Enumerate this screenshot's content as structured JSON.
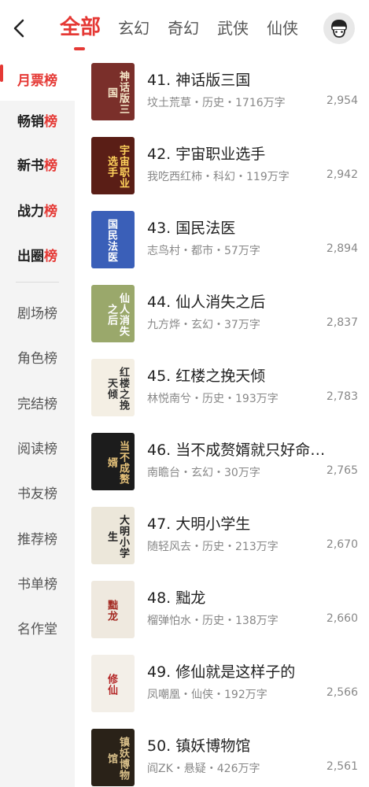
{
  "header": {
    "tabs": [
      "全部",
      "玄幻",
      "奇幻",
      "武侠",
      "仙侠"
    ],
    "active_tab": 0
  },
  "sidebar": {
    "primary": [
      "月票榜",
      "畅销榜",
      "新书榜",
      "战力榜",
      "出圈榜"
    ],
    "secondary": [
      "剧场榜",
      "角色榜",
      "完结榜",
      "阅读榜",
      "书友榜",
      "推荐榜",
      "书单榜",
      "名作堂"
    ]
  },
  "books": [
    {
      "title": "41. 神话版三国",
      "meta": "坟土荒草・历史・1716万字",
      "count": "2,954",
      "cover_text": "神话版三国",
      "cover_bg": "#7a2f2a",
      "cover_fg": "#f5e6c8"
    },
    {
      "title": "42. 宇宙职业选手",
      "meta": "我吃西红柿・科幻・119万字",
      "count": "2,942",
      "cover_text": "宇宙职业选手",
      "cover_bg": "#5a1e16",
      "cover_fg": "#ffd35c"
    },
    {
      "title": "43. 国民法医",
      "meta": "志鸟村・都市・57万字",
      "count": "2,894",
      "cover_text": "国民法医",
      "cover_bg": "#3a5fb8",
      "cover_fg": "#ffffff"
    },
    {
      "title": "44. 仙人消失之后",
      "meta": "九方烨・玄幻・37万字",
      "count": "2,837",
      "cover_text": "仙人消失之后",
      "cover_bg": "#9aa86b",
      "cover_fg": "#ffffff"
    },
    {
      "title": "45. 红楼之挽天倾",
      "meta": "林悦南兮・历史・193万字",
      "count": "2,783",
      "cover_text": "红楼之挽天倾",
      "cover_bg": "#f4efe4",
      "cover_fg": "#333333"
    },
    {
      "title": "46. 当不成赘婿就只好命…",
      "meta": "南瞻台・玄幻・30万字",
      "count": "2,765",
      "cover_text": "当不成赘婿",
      "cover_bg": "#1c1c1c",
      "cover_fg": "#e6c27a"
    },
    {
      "title": "47. 大明小学生",
      "meta": "随轻风去・历史・213万字",
      "count": "2,670",
      "cover_text": "大明小学生",
      "cover_bg": "#ece7da",
      "cover_fg": "#222222"
    },
    {
      "title": "48. 黜龙",
      "meta": "榴弹怕水・历史・138万字",
      "count": "2,660",
      "cover_text": "黜龙",
      "cover_bg": "#efe9df",
      "cover_fg": "#a32a22"
    },
    {
      "title": "49. 修仙就是这样子的",
      "meta": "凤嘲凰・仙侠・192万字",
      "count": "2,566",
      "cover_text": "修仙",
      "cover_bg": "#f3efe8",
      "cover_fg": "#b52a2a"
    },
    {
      "title": "50. 镇妖博物馆",
      "meta": "阎ZK・悬疑・426万字",
      "count": "2,561",
      "cover_text": "镇妖博物馆",
      "cover_bg": "#2a2218",
      "cover_fg": "#d9c08a"
    }
  ]
}
